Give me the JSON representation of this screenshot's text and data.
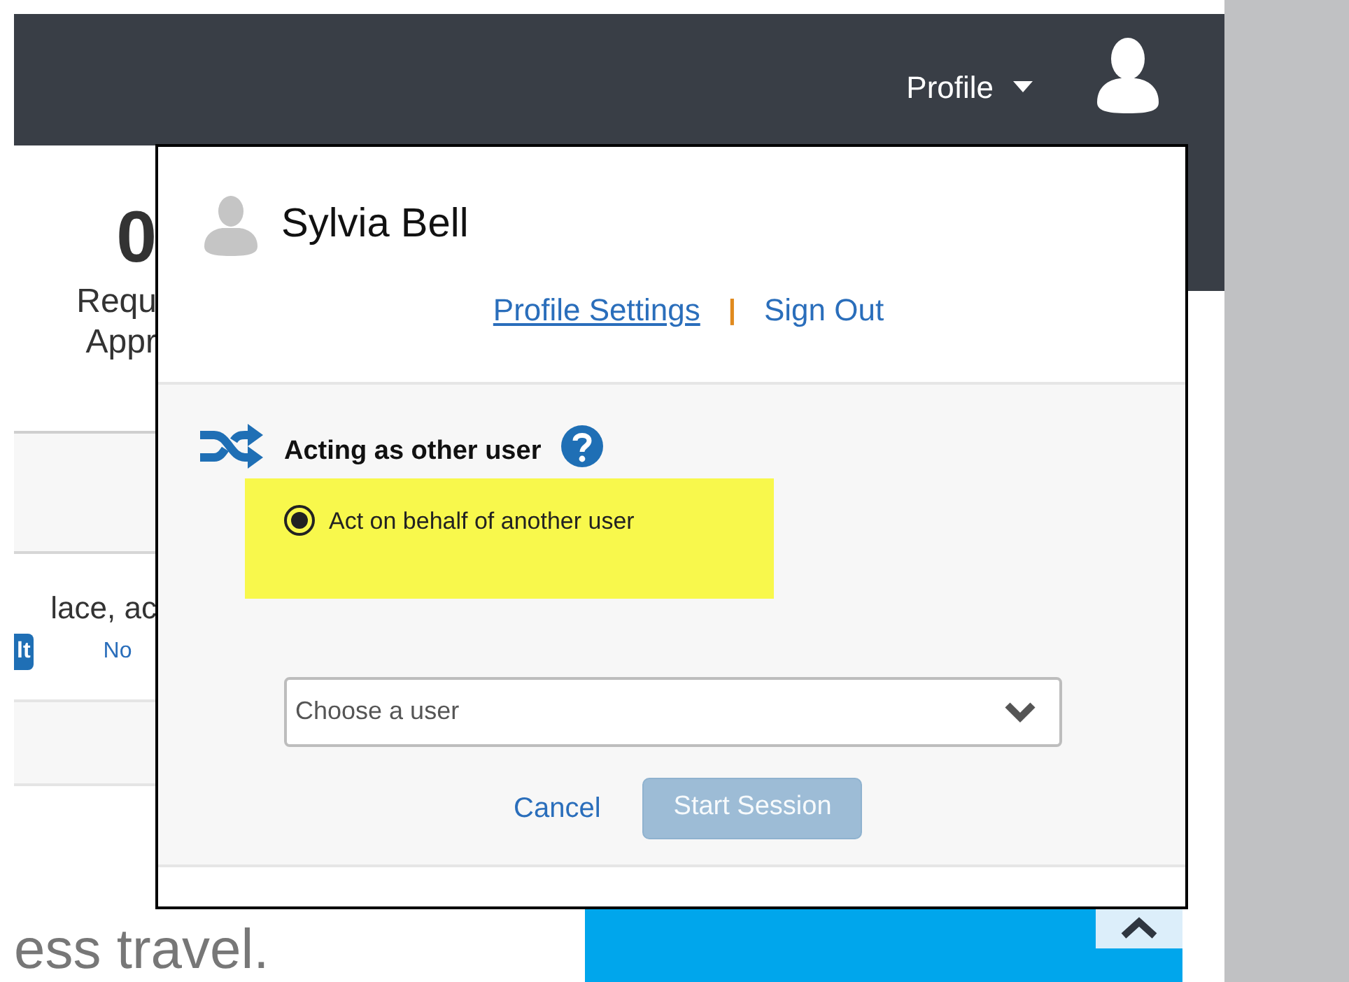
{
  "header": {
    "menu_label": "Profile"
  },
  "background": {
    "stat_value": "0",
    "stat_label_lines": [
      "Requ",
      "Appr"
    ],
    "text_fragment": "lace, ac",
    "button_fragment": "lt",
    "link_fragment": "No",
    "headline_fragment": "ess travel."
  },
  "profile_popup": {
    "user_name": "Sylvia Bell",
    "links": [
      "Profile Settings",
      "Sign Out"
    ],
    "separator": "|",
    "section_title": "Acting as other user",
    "options": [
      {
        "label": "Act on behalf of another user",
        "selected": true,
        "highlighted": true
      }
    ],
    "user_select": {
      "placeholder": "Choose a user"
    },
    "cancel": "Cancel",
    "start_button": {
      "label": "Start Session",
      "disabled": true
    }
  }
}
